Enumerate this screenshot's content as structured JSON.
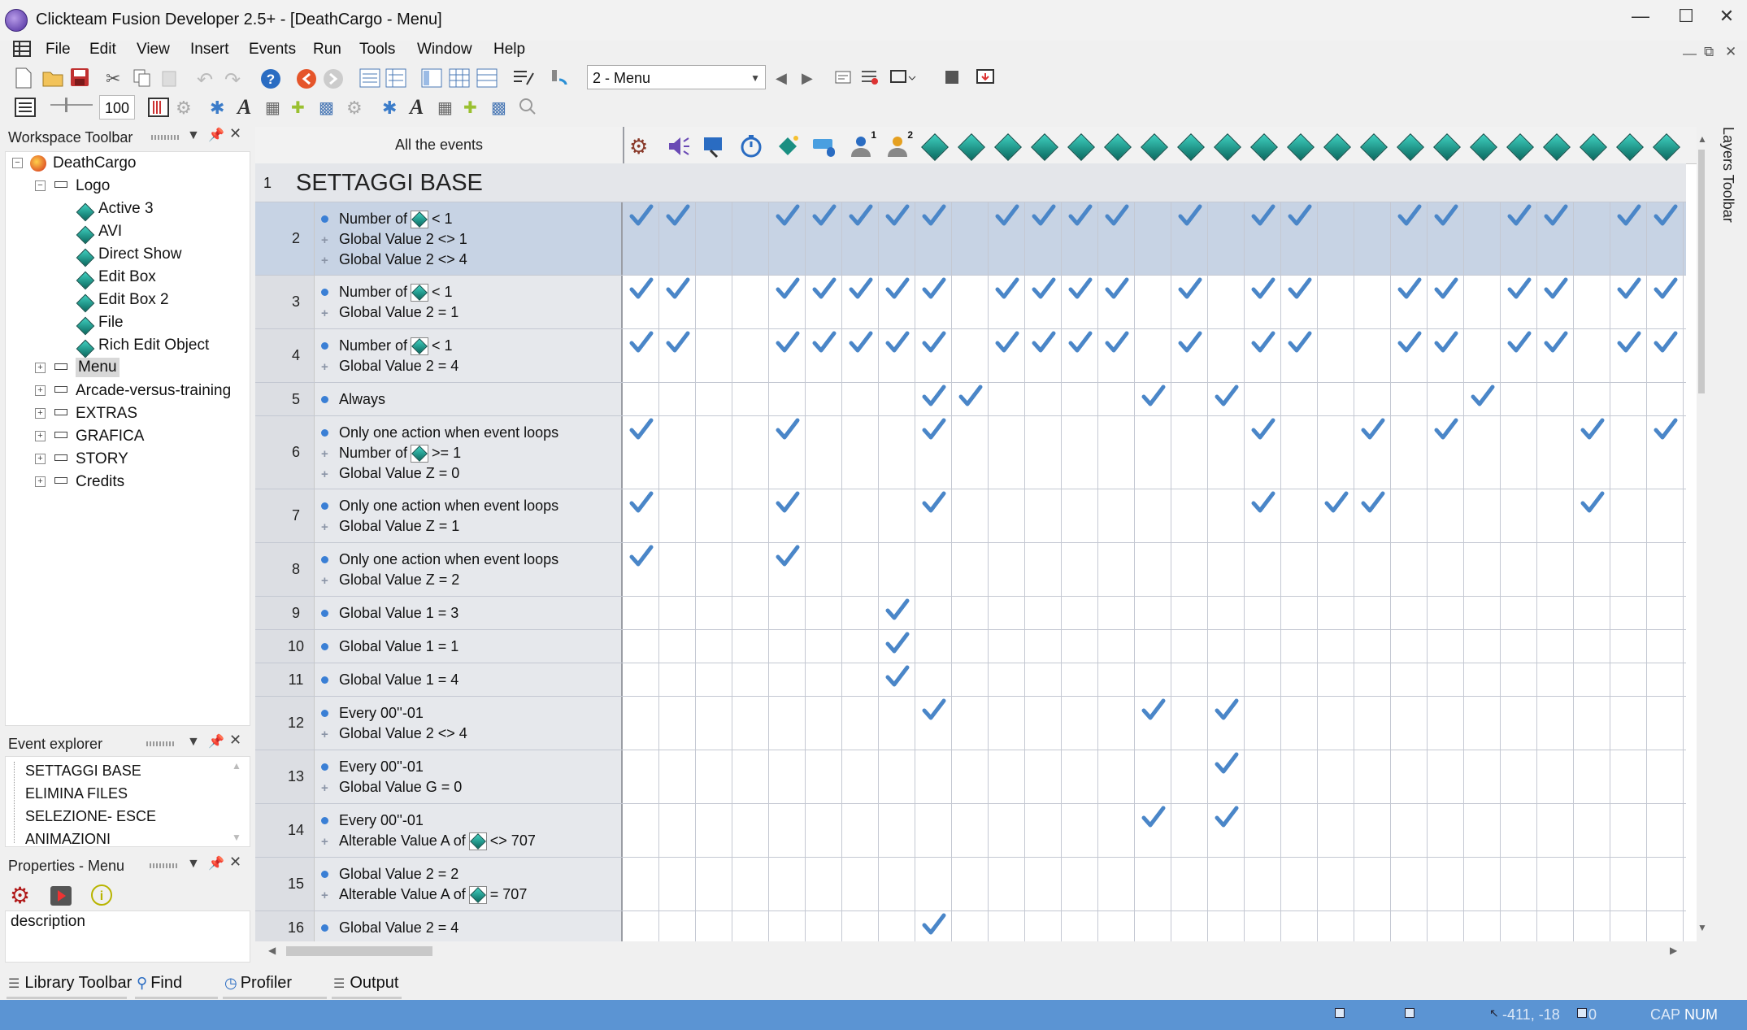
{
  "window": {
    "title": "Clickteam Fusion Developer 2.5+ - [DeathCargo - Menu]",
    "controls": [
      "—",
      "☐",
      "✕"
    ]
  },
  "menu": [
    "File",
    "Edit",
    "View",
    "Insert",
    "Events",
    "Run",
    "Tools",
    "Window",
    "Help"
  ],
  "mdi_controls": [
    "—",
    "⧉",
    "✕"
  ],
  "toolbar": {
    "frame_select": "2 - Menu",
    "zoom_value": "100"
  },
  "workspace": {
    "title": "Workspace Toolbar",
    "root": "DeathCargo",
    "frame1": "Logo",
    "objects": [
      "Active 3",
      "AVI",
      "Direct Show",
      "Edit Box",
      "Edit Box 2",
      "File",
      "Rich Edit Object"
    ],
    "frames": [
      "Menu",
      "Arcade-versus-training",
      "EXTRAS",
      "GRAFICA",
      "STORY",
      "Credits"
    ]
  },
  "event_explorer": {
    "title": "Event explorer",
    "items": [
      "SETTAGGI BASE",
      "ELIMINA FILES",
      "SELEZIONE- ESCE",
      "ANIMAZIONI"
    ]
  },
  "properties": {
    "title": "Properties - Menu",
    "field": "description"
  },
  "editor": {
    "header": "All the events",
    "header_superscripts": [
      "1",
      "2"
    ],
    "group_number": "1",
    "group_title": "SETTAGGI BASE",
    "rows": [
      {
        "num": "2",
        "conds": [
          {
            "pre": "Number of",
            "obj": true,
            "post": "< 1"
          },
          {
            "pre": "Global Value 2 <> 1"
          },
          {
            "pre": "Global Value 2 <> 4"
          }
        ],
        "checks": [
          0,
          1,
          4,
          5,
          6,
          7,
          8,
          10,
          11,
          12,
          13,
          15,
          17,
          18,
          21,
          22,
          24,
          25,
          27,
          28
        ]
      },
      {
        "num": "3",
        "conds": [
          {
            "pre": "Number of",
            "obj": true,
            "post": "< 1"
          },
          {
            "pre": "Global Value 2 = 1"
          }
        ],
        "checks": [
          0,
          1,
          4,
          5,
          6,
          7,
          8,
          10,
          11,
          12,
          13,
          15,
          17,
          18,
          21,
          22,
          24,
          25,
          27,
          28
        ]
      },
      {
        "num": "4",
        "conds": [
          {
            "pre": "Number of",
            "obj": true,
            "post": "< 1"
          },
          {
            "pre": "Global Value 2 = 4"
          }
        ],
        "checks": [
          0,
          1,
          4,
          5,
          6,
          7,
          8,
          10,
          11,
          12,
          13,
          15,
          17,
          18,
          21,
          22,
          24,
          25,
          27,
          28
        ]
      },
      {
        "num": "5",
        "conds": [
          {
            "pre": "Always"
          }
        ],
        "checks": [
          8,
          9,
          14,
          16,
          23
        ]
      },
      {
        "num": "6",
        "conds": [
          {
            "pre": "Only one action when event loops"
          },
          {
            "pre": "Number of",
            "obj": true,
            "post": ">= 1"
          },
          {
            "pre": "Global Value Z = 0"
          }
        ],
        "checks": [
          0,
          4,
          8,
          17,
          20,
          22,
          26,
          28
        ]
      },
      {
        "num": "7",
        "conds": [
          {
            "pre": "Only one action when event loops"
          },
          {
            "pre": "Global Value Z = 1"
          }
        ],
        "checks": [
          0,
          4,
          8,
          17,
          19,
          20,
          26
        ]
      },
      {
        "num": "8",
        "conds": [
          {
            "pre": "Only one action when event loops"
          },
          {
            "pre": "Global Value Z = 2"
          }
        ],
        "checks": [
          0,
          4
        ]
      },
      {
        "num": "9",
        "conds": [
          {
            "pre": "Global Value 1 = 3"
          }
        ],
        "checks": [
          7
        ]
      },
      {
        "num": "10",
        "conds": [
          {
            "pre": "Global Value 1 = 1"
          }
        ],
        "checks": [
          7
        ]
      },
      {
        "num": "11",
        "conds": [
          {
            "pre": "Global Value 1 = 4"
          }
        ],
        "checks": [
          7
        ]
      },
      {
        "num": "12",
        "conds": [
          {
            "pre": "Every 00''-01"
          },
          {
            "pre": "Global Value 2 <> 4"
          }
        ],
        "checks": [
          8,
          14,
          16
        ]
      },
      {
        "num": "13",
        "conds": [
          {
            "pre": "Every 00''-01"
          },
          {
            "pre": "Global Value G = 0"
          }
        ],
        "checks": [
          16
        ]
      },
      {
        "num": "14",
        "conds": [
          {
            "pre": "Every 00''-01"
          },
          {
            "pre": "Alterable Value A of",
            "obj": true,
            "post": "<> 707"
          }
        ],
        "checks": [
          14,
          16
        ]
      },
      {
        "num": "15",
        "conds": [
          {
            "pre": "Global Value 2 = 2"
          },
          {
            "pre": "Alterable Value A of",
            "obj": true,
            "post": "= 707"
          }
        ],
        "checks": []
      },
      {
        "num": "16",
        "conds": [
          {
            "pre": "Global Value 2 = 4"
          }
        ],
        "checks": [
          8
        ]
      }
    ]
  },
  "layers_toolbar": "Layers Toolbar",
  "bottom_tabs": [
    "Library Toolbar",
    "Find",
    "Profiler",
    "Output"
  ],
  "status": {
    "coords": "-411, -18",
    "zero": "0",
    "cap": "CAP",
    "num": "NUM"
  },
  "colors": {
    "check": "#4a86c8",
    "selected_row": "#c7d3e4",
    "statusbar": "#5b94d3",
    "diamond": "#1a8f82"
  }
}
